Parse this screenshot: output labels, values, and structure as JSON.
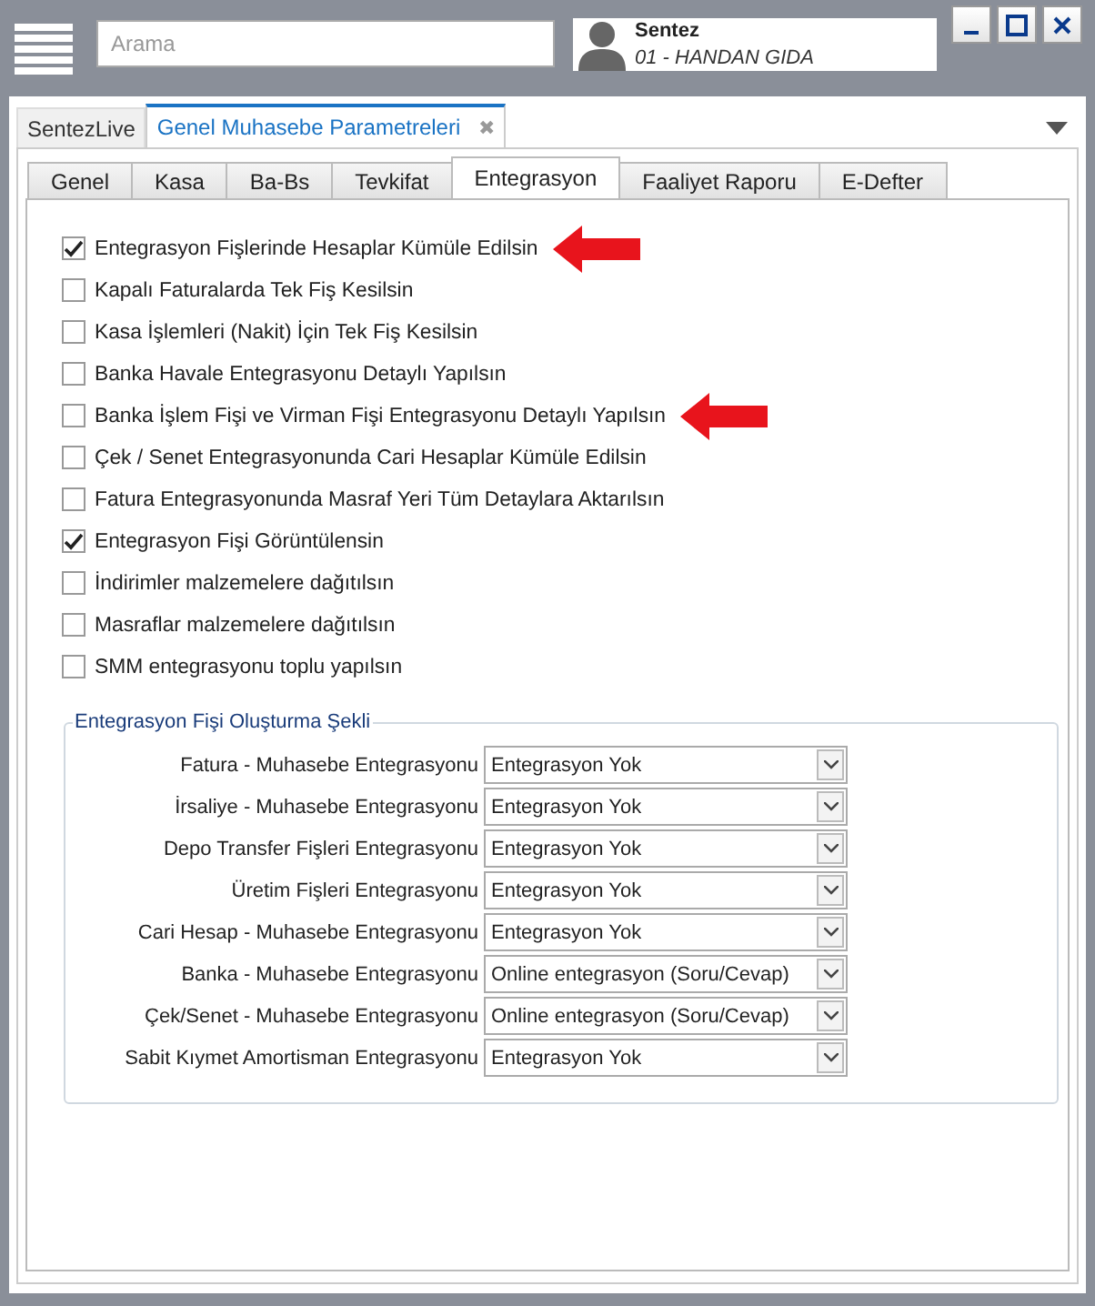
{
  "search": {
    "placeholder": "Arama"
  },
  "user": {
    "name": "Sentez",
    "company": "01 - HANDAN GIDA"
  },
  "doc_tabs": [
    {
      "label": "SentezLive",
      "selected": false,
      "closable": false
    },
    {
      "label": "Genel Muhasebe Parametreleri",
      "selected": true,
      "closable": true,
      "close": "✖"
    }
  ],
  "tabs": [
    {
      "label": "Genel",
      "selected": false
    },
    {
      "label": "Kasa",
      "selected": false
    },
    {
      "label": "Ba-Bs",
      "selected": false
    },
    {
      "label": "Tevkifat",
      "selected": false
    },
    {
      "label": "Entegrasyon",
      "selected": true
    },
    {
      "label": "Faaliyet Raporu",
      "selected": false
    },
    {
      "label": "E-Defter",
      "selected": false
    }
  ],
  "options": [
    {
      "label": "Entegrasyon Fişlerinde Hesaplar Kümüle Edilsin",
      "checked": true,
      "highlighted": true
    },
    {
      "label": "Kapalı Faturalarda Tek Fiş Kesilsin",
      "checked": false,
      "highlighted": false
    },
    {
      "label": "Kasa İşlemleri (Nakit) İçin Tek Fiş Kesilsin",
      "checked": false,
      "highlighted": false
    },
    {
      "label": "Banka Havale Entegrasyonu Detaylı Yapılsın",
      "checked": false,
      "highlighted": false
    },
    {
      "label": "Banka İşlem Fişi ve Virman Fişi Entegrasyonu Detaylı Yapılsın",
      "checked": false,
      "highlighted": true
    },
    {
      "label": "Çek / Senet Entegrasyonunda Cari Hesaplar Kümüle Edilsin",
      "checked": false,
      "highlighted": false
    },
    {
      "label": "Fatura Entegrasyonunda Masraf Yeri Tüm Detaylara Aktarılsın",
      "checked": false,
      "highlighted": false
    },
    {
      "label": "Entegrasyon Fişi Görüntülensin",
      "checked": true,
      "highlighted": false
    },
    {
      "label": "İndirimler malzemelere dağıtılsın",
      "checked": false,
      "highlighted": false
    },
    {
      "label": "Masraflar malzemelere dağıtılsın",
      "checked": false,
      "highlighted": false
    },
    {
      "label": "SMM entegrasyonu toplu yapılsın",
      "checked": false,
      "highlighted": false
    }
  ],
  "group": {
    "title": "Entegrasyon Fişi Oluşturma Şekli",
    "fields": [
      {
        "label": "Fatura - Muhasebe Entegrasyonu",
        "value": "Entegrasyon Yok"
      },
      {
        "label": "İrsaliye - Muhasebe Entegrasyonu",
        "value": "Entegrasyon Yok"
      },
      {
        "label": "Depo Transfer Fişleri Entegrasyonu",
        "value": "Entegrasyon Yok"
      },
      {
        "label": "Üretim Fişleri Entegrasyonu",
        "value": "Entegrasyon Yok"
      },
      {
        "label": "Cari Hesap - Muhasebe Entegrasyonu",
        "value": "Entegrasyon Yok"
      },
      {
        "label": "Banka - Muhasebe Entegrasyonu",
        "value": "Online entegrasyon (Soru/Cevap)"
      },
      {
        "label": "Çek/Senet - Muhasebe Entegrasyonu",
        "value": "Online entegrasyon (Soru/Cevap)"
      },
      {
        "label": "Sabit Kıymet Amortisman Entegrasyonu",
        "value": "Entegrasyon Yok"
      }
    ]
  }
}
